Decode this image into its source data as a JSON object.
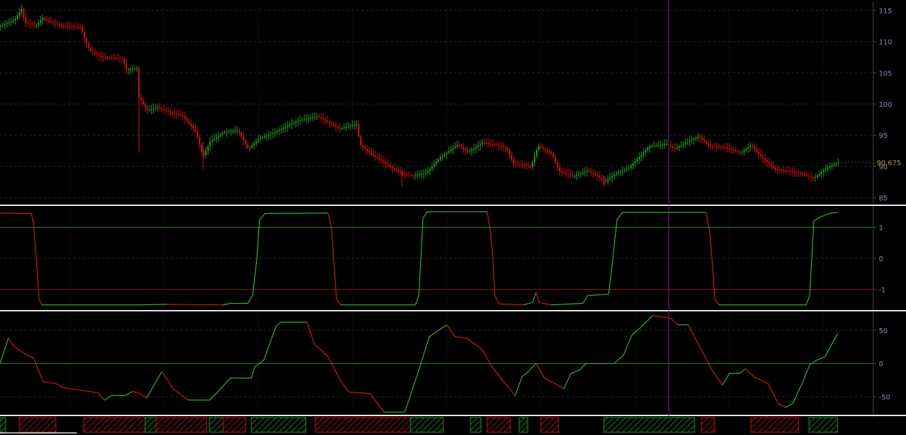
{
  "colors": {
    "background": "#000000",
    "bull": "#1f9a1f",
    "bear": "#cc1010",
    "grid": "#2a2a2a",
    "separator": "#e8e8e8",
    "axis_text": "#8a8ab8",
    "cursor": "#7a2a7a",
    "level_line_green": "#1a8a1a",
    "level_line_red": "#8a1a1a",
    "last_price": "#b0a030"
  },
  "chart_data": [
    {
      "type": "candlestick",
      "panel": "price",
      "ylim": [
        84,
        116
      ],
      "yticks": [
        "115",
        "110",
        "105",
        "100",
        "95",
        "90",
        "85"
      ],
      "ytick_values": [
        115,
        110,
        105,
        100,
        95,
        90,
        85
      ],
      "last_price": "90.675",
      "x_range": [
        0,
        1200
      ],
      "closes": [
        [
          0,
          112.5
        ],
        [
          20,
          113.5
        ],
        [
          30,
          115.2
        ],
        [
          35,
          113.0
        ],
        [
          50,
          112.5
        ],
        [
          60,
          113.8
        ],
        [
          70,
          113.2
        ],
        [
          90,
          112.5
        ],
        [
          115,
          112.3
        ],
        [
          120,
          110.5
        ],
        [
          128,
          108.5
        ],
        [
          145,
          107.5
        ],
        [
          175,
          107.3
        ],
        [
          180,
          105.5
        ],
        [
          196,
          105.8
        ],
        [
          198,
          101.0
        ],
        [
          210,
          99.0
        ],
        [
          225,
          99.5
        ],
        [
          240,
          98.7
        ],
        [
          260,
          98.2
        ],
        [
          280,
          95.5
        ],
        [
          290,
          91.5
        ],
        [
          300,
          94.0
        ],
        [
          320,
          95.5
        ],
        [
          340,
          95.8
        ],
        [
          355,
          92.8
        ],
        [
          370,
          94.5
        ],
        [
          390,
          95.3
        ],
        [
          410,
          96.5
        ],
        [
          430,
          97.5
        ],
        [
          455,
          98.0
        ],
        [
          470,
          97.0
        ],
        [
          485,
          96.0
        ],
        [
          510,
          96.8
        ],
        [
          515,
          93.5
        ],
        [
          530,
          92.0
        ],
        [
          545,
          91.0
        ],
        [
          560,
          89.8
        ],
        [
          575,
          88.8
        ],
        [
          590,
          88.5
        ],
        [
          610,
          89.0
        ],
        [
          630,
          91.5
        ],
        [
          655,
          93.5
        ],
        [
          670,
          92.3
        ],
        [
          690,
          93.8
        ],
        [
          710,
          93.5
        ],
        [
          725,
          92.8
        ],
        [
          735,
          90.5
        ],
        [
          760,
          90.0
        ],
        [
          770,
          93.3
        ],
        [
          790,
          92.0
        ],
        [
          800,
          89.3
        ],
        [
          820,
          88.4
        ],
        [
          840,
          89.3
        ],
        [
          855,
          88.5
        ],
        [
          865,
          87.5
        ],
        [
          880,
          88.8
        ],
        [
          900,
          89.8
        ],
        [
          915,
          91.5
        ],
        [
          930,
          93.3
        ],
        [
          955,
          93.6
        ],
        [
          965,
          92.8
        ],
        [
          985,
          94.0
        ],
        [
          1000,
          94.8
        ],
        [
          1015,
          93.3
        ],
        [
          1040,
          93.0
        ],
        [
          1060,
          92.2
        ],
        [
          1075,
          93.4
        ],
        [
          1090,
          91.5
        ],
        [
          1110,
          89.5
        ],
        [
          1130,
          89.2
        ],
        [
          1150,
          88.8
        ],
        [
          1165,
          88.1
        ],
        [
          1180,
          89.5
        ],
        [
          1200,
          90.7
        ]
      ]
    },
    {
      "type": "line",
      "panel": "oscillator-bipolar",
      "ylim": [
        -1.62,
        1.62
      ],
      "yticks": [
        "1",
        "0",
        "-1"
      ],
      "ytick_values": [
        1,
        0,
        -1
      ],
      "levels": [
        1,
        -1
      ],
      "x_range": [
        0,
        1200
      ],
      "series": [
        {
          "values": [
            [
              0,
              1.46
            ],
            [
              45,
              1.45
            ],
            [
              48,
              1.1
            ],
            [
              52,
              0.0
            ],
            [
              56,
              -1.3
            ],
            [
              60,
              -1.5
            ],
            [
              200,
              -1.5
            ],
            [
              240,
              -1.48
            ],
            [
              320,
              -1.5
            ],
            [
              330,
              -1.45
            ],
            [
              355,
              -1.45
            ],
            [
              362,
              -1.2
            ],
            [
              368,
              0.0
            ],
            [
              372,
              1.25
            ],
            [
              380,
              1.45
            ],
            [
              470,
              1.46
            ],
            [
              475,
              1.0
            ],
            [
              478,
              0.0
            ],
            [
              482,
              -1.3
            ],
            [
              488,
              -1.5
            ],
            [
              595,
              -1.5
            ],
            [
              600,
              -1.2
            ],
            [
              603,
              0.0
            ],
            [
              606,
              1.3
            ],
            [
              612,
              1.5
            ],
            [
              698,
              1.5
            ],
            [
              703,
              0.8
            ],
            [
              706,
              0.0
            ],
            [
              709,
              -1.2
            ],
            [
              715,
              -1.47
            ],
            [
              750,
              -1.5
            ],
            [
              763,
              -1.42
            ],
            [
              768,
              -1.1
            ],
            [
              772,
              -1.42
            ],
            [
              790,
              -1.5
            ],
            [
              835,
              -1.45
            ],
            [
              842,
              -1.2
            ],
            [
              872,
              -1.15
            ],
            [
              878,
              0.0
            ],
            [
              884,
              1.25
            ],
            [
              892,
              1.48
            ],
            [
              1012,
              1.48
            ],
            [
              1017,
              0.8
            ],
            [
              1020,
              0.0
            ],
            [
              1024,
              -1.3
            ],
            [
              1030,
              -1.5
            ],
            [
              1155,
              -1.5
            ],
            [
              1160,
              -1.2
            ],
            [
              1163,
              0.0
            ],
            [
              1166,
              1.2
            ],
            [
              1175,
              1.33
            ],
            [
              1190,
              1.46
            ],
            [
              1200,
              1.48
            ]
          ]
        }
      ]
    },
    {
      "type": "line",
      "panel": "oscillator",
      "ylim": [
        -76,
        76
      ],
      "yticks": [
        "50",
        "0",
        "-50"
      ],
      "ytick_values": [
        50,
        0,
        -50
      ],
      "levels": [
        0
      ],
      "x_range": [
        0,
        1200
      ],
      "series": [
        {
          "values": [
            [
              0,
              0
            ],
            [
              12,
              38
            ],
            [
              20,
              25
            ],
            [
              35,
              15
            ],
            [
              48,
              8
            ],
            [
              62,
              -28
            ],
            [
              80,
              -30
            ],
            [
              90,
              -36
            ],
            [
              100,
              -38
            ],
            [
              140,
              -44
            ],
            [
              150,
              -55
            ],
            [
              160,
              -48
            ],
            [
              180,
              -48
            ],
            [
              190,
              -42
            ],
            [
              200,
              -45
            ],
            [
              210,
              -52
            ],
            [
              232,
              -12
            ],
            [
              248,
              -38
            ],
            [
              260,
              -48
            ],
            [
              270,
              -55
            ],
            [
              300,
              -55
            ],
            [
              310,
              -45
            ],
            [
              330,
              -22
            ],
            [
              360,
              -22
            ],
            [
              365,
              -5
            ],
            [
              378,
              5
            ],
            [
              395,
              55
            ],
            [
              402,
              62
            ],
            [
              440,
              62
            ],
            [
              450,
              30
            ],
            [
              470,
              10
            ],
            [
              490,
              -30
            ],
            [
              500,
              -43
            ],
            [
              530,
              -45
            ],
            [
              550,
              -73
            ],
            [
              580,
              -73
            ],
            [
              600,
              -10
            ],
            [
              615,
              40
            ],
            [
              640,
              58
            ],
            [
              652,
              40
            ],
            [
              668,
              38
            ],
            [
              690,
              22
            ],
            [
              705,
              -5
            ],
            [
              720,
              -25
            ],
            [
              738,
              -48
            ],
            [
              748,
              -20
            ],
            [
              757,
              -12
            ],
            [
              768,
              0
            ],
            [
              780,
              -22
            ],
            [
              795,
              -30
            ],
            [
              808,
              -38
            ],
            [
              818,
              -15
            ],
            [
              830,
              -10
            ],
            [
              840,
              0
            ],
            [
              880,
              0
            ],
            [
              893,
              12
            ],
            [
              905,
              42
            ],
            [
              922,
              58
            ],
            [
              935,
              72
            ],
            [
              960,
              68
            ],
            [
              972,
              58
            ],
            [
              986,
              58
            ],
            [
              1000,
              30
            ],
            [
              1020,
              -10
            ],
            [
              1035,
              -32
            ],
            [
              1045,
              -15
            ],
            [
              1060,
              -15
            ],
            [
              1068,
              -8
            ],
            [
              1080,
              -20
            ],
            [
              1100,
              -30
            ],
            [
              1115,
              -60
            ],
            [
              1125,
              -66
            ],
            [
              1136,
              -60
            ],
            [
              1150,
              -28
            ],
            [
              1160,
              -2
            ],
            [
              1170,
              5
            ],
            [
              1182,
              10
            ],
            [
              1200,
              45
            ]
          ]
        }
      ]
    },
    {
      "type": "signal_strip",
      "panel": "regime-bars",
      "x_range": [
        0,
        1200
      ],
      "segments": [
        {
          "range": [
            0,
            8
          ],
          "trend": "bull"
        },
        {
          "range": [
            28,
            80
          ],
          "trend": "bear"
        },
        {
          "range": [
            120,
            208
          ],
          "trend": "bear"
        },
        {
          "range": [
            208,
            224
          ],
          "trend": "bull"
        },
        {
          "range": [
            224,
            296
          ],
          "trend": "bear"
        },
        {
          "range": [
            300,
            320
          ],
          "trend": "bull"
        },
        {
          "range": [
            320,
            352
          ],
          "trend": "bear"
        },
        {
          "range": [
            360,
            438
          ],
          "trend": "bull"
        },
        {
          "range": [
            452,
            588
          ],
          "trend": "bear"
        },
        {
          "range": [
            588,
            635
          ],
          "trend": "bull"
        },
        {
          "range": [
            674,
            689
          ],
          "trend": "bull"
        },
        {
          "range": [
            698,
            731
          ],
          "trend": "bear"
        },
        {
          "range": [
            744,
            756
          ],
          "trend": "bull"
        },
        {
          "range": [
            775,
            800
          ],
          "trend": "bear"
        },
        {
          "range": [
            865,
            995
          ],
          "trend": "bull"
        },
        {
          "range": [
            1005,
            1024
          ],
          "trend": "bear"
        },
        {
          "range": [
            1076,
            1144
          ],
          "trend": "bear"
        },
        {
          "range": [
            1159,
            1200
          ],
          "trend": "bull"
        }
      ]
    }
  ],
  "cursor": {
    "x": 958
  }
}
